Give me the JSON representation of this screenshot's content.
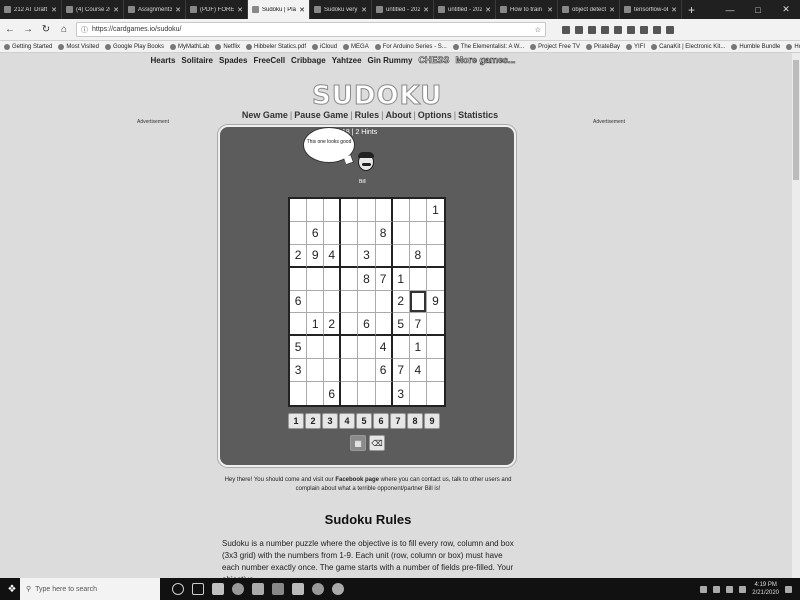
{
  "browser": {
    "tabs": [
      {
        "label": "212 AT Draft - Out"
      },
      {
        "label": "(4) Course 202001 M"
      },
      {
        "label": "Assignment3.pdf"
      },
      {
        "label": "(PDF) FORECASTIN"
      },
      {
        "label": "Sudoku | Play onli",
        "active": true
      },
      {
        "label": "Sudoku very diffi"
      },
      {
        "label": "untitled - 202002"
      },
      {
        "label": "untitled - 202002"
      },
      {
        "label": "How to train an o"
      },
      {
        "label": "object detection"
      },
      {
        "label": "tensorflow-obje"
      }
    ],
    "new_tab": "+",
    "url": "https://cardgames.io/sudoku/",
    "bookmarks": [
      "Getting Started",
      "Most Visited",
      "Google Play Books",
      "MyMathLab",
      "Netflix",
      "Hibbeler Statics.pdf",
      "iCloud",
      "MEGA",
      "For Arduino Series - S...",
      "The Elementalist: A W...",
      "Project Free TV",
      "PirateBay",
      "YIFI",
      "CanaKit | Electronic Kit...",
      "Humble Bundle",
      "Home - Study in Germ..."
    ]
  },
  "site": {
    "game_links": [
      "Hearts",
      "Solitaire",
      "Spades",
      "FreeCell",
      "Cribbage",
      "Yahtzee",
      "Gin Rummy",
      "CHESS",
      "More games..."
    ],
    "logo": "SUDOKU",
    "menu": [
      "New Game",
      "Pause Game",
      "Rules",
      "About",
      "Options",
      "Statistics"
    ],
    "ad_left": "Advertisement",
    "ad_right": "Advertisement",
    "status": ":18 | 2 Hints",
    "bubble": "This one looks good",
    "avatar_name": "Bill",
    "numpad": [
      "1",
      "2",
      "3",
      "4",
      "5",
      "6",
      "7",
      "8",
      "9"
    ],
    "fb_pre": "Hey there! You should come and visit our ",
    "fb_link": "Facebook page",
    "fb_post": " where you can contact us, talk to other users and complain about what a terrible opponent/partner Bill is!",
    "rules_title": "Sudoku Rules",
    "rules_text": "Sudoku is a number puzzle where the objective is to fill every row, column and box (3x3 grid) with the numbers from 1-9. Each unit (row, column or box) must have each number exactly once. The game starts with a number of fields pre-filled. Your objective"
  },
  "board": [
    [
      "",
      "",
      "",
      "",
      "",
      "",
      "",
      "",
      "1"
    ],
    [
      "",
      "6",
      "",
      "",
      "",
      "8",
      "",
      "",
      ""
    ],
    [
      "2",
      "9",
      "4",
      "",
      "3",
      "",
      "",
      "8",
      ""
    ],
    [
      "",
      "",
      "",
      "",
      "8",
      "7",
      "1",
      "",
      ""
    ],
    [
      "6",
      "",
      "",
      "",
      "",
      "",
      "2",
      "",
      "9"
    ],
    [
      "",
      "1",
      "2",
      "",
      "6",
      "",
      "5",
      "7",
      ""
    ],
    [
      "5",
      "",
      "",
      "",
      "",
      "4",
      "",
      "1",
      ""
    ],
    [
      "3",
      "",
      "",
      "",
      "",
      "6",
      "7",
      "4",
      ""
    ],
    [
      "",
      "",
      "6",
      "",
      "",
      "",
      "3",
      "",
      ""
    ]
  ],
  "selected_cell": [
    4,
    7
  ],
  "taskbar": {
    "search_placeholder": "Type here to search",
    "time": "4:19 PM",
    "date": "2/21/2020"
  }
}
